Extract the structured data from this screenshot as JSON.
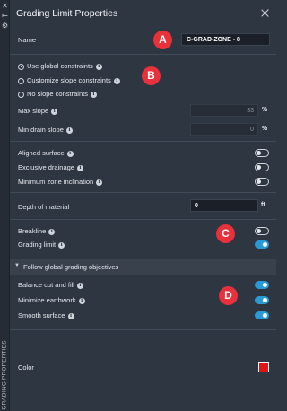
{
  "rail": {
    "side_label": "GRADING PROPERTIES"
  },
  "panel": {
    "title": "Grading Limit Properties"
  },
  "name": {
    "label": "Name",
    "value": "C-GRAD-ZONE - 8"
  },
  "constraints": {
    "options": [
      {
        "label": "Use global constraints",
        "selected": true
      },
      {
        "label": "Customize slope constraints",
        "selected": false
      },
      {
        "label": "No slope constraints",
        "selected": false
      }
    ]
  },
  "slopes": {
    "max_label": "Max slope",
    "max_value": "33",
    "max_unit": "%",
    "min_label": "Min drain slope",
    "min_value": "0",
    "min_unit": "%"
  },
  "surface_toggles": [
    {
      "label": "Aligned surface",
      "on": false
    },
    {
      "label": "Exclusive drainage",
      "on": false
    },
    {
      "label": "Minimum zone inclination",
      "on": false
    }
  ],
  "depth": {
    "label": "Depth of material",
    "value": "0",
    "unit": "ft"
  },
  "line_toggles": [
    {
      "label": "Breakline",
      "on": false
    },
    {
      "label": "Grading limit",
      "on": true
    }
  ],
  "objectives": {
    "header": "Follow global grading objectives",
    "items": [
      {
        "label": "Balance cut and fill",
        "on": true
      },
      {
        "label": "Minimize earthwork",
        "on": true
      },
      {
        "label": "Smooth surface",
        "on": true
      }
    ]
  },
  "color": {
    "label": "Color",
    "value": "#e01616"
  },
  "callouts": {
    "a": "A",
    "b": "B",
    "c": "C",
    "d": "D"
  },
  "colors": {
    "accent": "#2a9ad6",
    "callout": "#e8313a",
    "background": "#2e3642"
  }
}
